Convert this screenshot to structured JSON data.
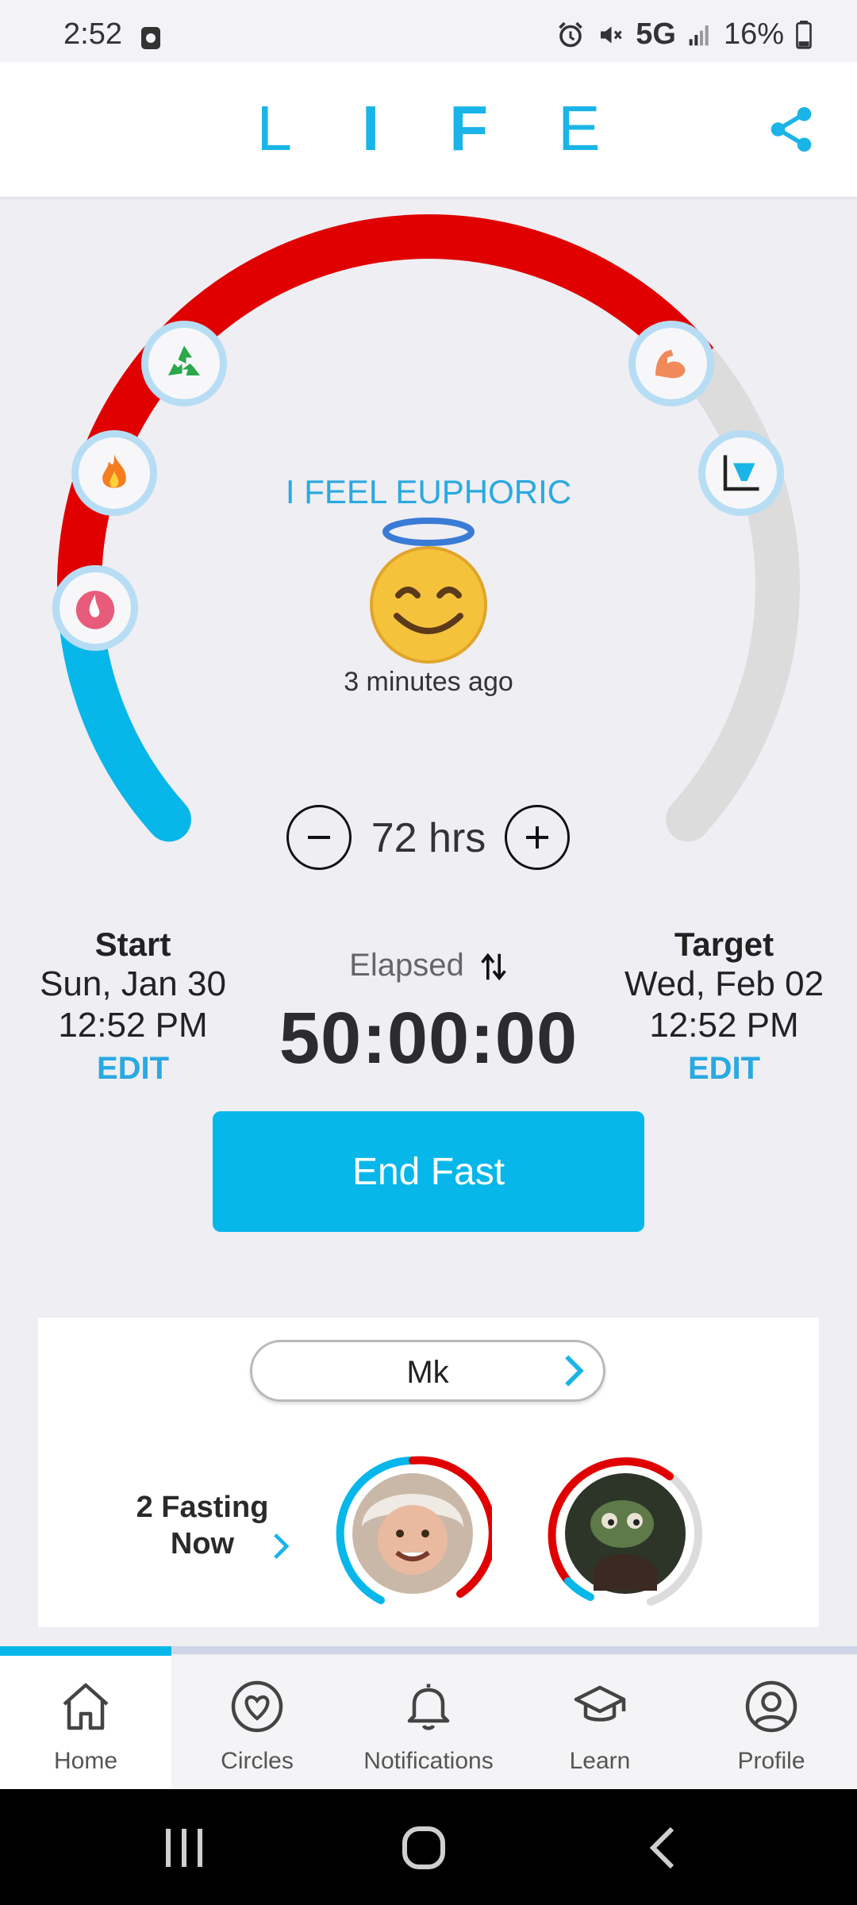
{
  "status_bar": {
    "time": "2:52",
    "network": "5G",
    "battery": "16%"
  },
  "header": {
    "logo_letters": [
      "L",
      "I",
      "F",
      "E"
    ]
  },
  "gauge": {
    "status_text": "I FEEL EUPHORIC",
    "time_ago": "3 minutes ago",
    "duration": "72 hrs",
    "progress_fraction": 0.69,
    "stage_icons": [
      "blood-drop-icon",
      "flame-icon",
      "recycle-icon",
      "muscle-arm-icon",
      "chart-icon"
    ]
  },
  "times": {
    "start": {
      "label": "Start",
      "date": "Sun, Jan 30",
      "time": "12:52 PM",
      "edit": "EDIT"
    },
    "target": {
      "label": "Target",
      "date": "Wed, Feb 02",
      "time": "12:52 PM",
      "edit": "EDIT"
    },
    "elapsed_label": "Elapsed",
    "elapsed_value": "50:00:00"
  },
  "end_button": "End Fast",
  "circle": {
    "name": "Mk",
    "fasting_line1": "2 Fasting",
    "fasting_line2": "Now"
  },
  "nav": {
    "items": [
      {
        "label": "Home",
        "icon": "home-icon"
      },
      {
        "label": "Circles",
        "icon": "heart-circle-icon"
      },
      {
        "label": "Notifications",
        "icon": "bell-icon"
      },
      {
        "label": "Learn",
        "icon": "graduation-cap-icon"
      },
      {
        "label": "Profile",
        "icon": "profile-icon"
      }
    ],
    "active": "Home"
  },
  "colors": {
    "accent": "#08b7ea",
    "progress_red": "#e00000",
    "track": "#dcdcdc"
  }
}
